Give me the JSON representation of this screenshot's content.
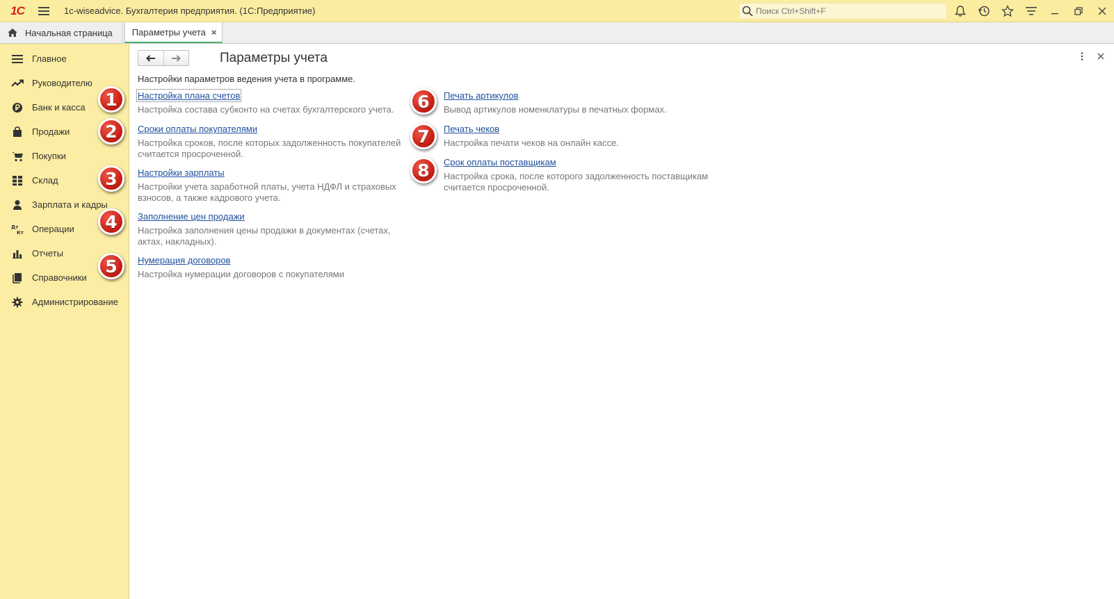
{
  "app": {
    "logo_text": "1С",
    "title": "1c-wiseadvice. Бухгалтерия предприятия.  (1С:Предприятие)",
    "search_placeholder": "Поиск Ctrl+Shift+F"
  },
  "tabs": {
    "home_label": "Начальная страница",
    "active_label": "Параметры учета",
    "close_glyph": "×"
  },
  "sidebar": {
    "items": [
      {
        "label": "Главное",
        "icon": "list-icon"
      },
      {
        "label": "Руководителю",
        "icon": "trend-icon"
      },
      {
        "label": "Банк и касса",
        "icon": "ruble-icon"
      },
      {
        "label": "Продажи",
        "icon": "bag-icon"
      },
      {
        "label": "Покупки",
        "icon": "cart-icon"
      },
      {
        "label": "Склад",
        "icon": "grid-icon"
      },
      {
        "label": "Зарплата и кадры",
        "icon": "person-icon"
      },
      {
        "label": "Операции",
        "icon": "dtkt-icon"
      },
      {
        "label": "Отчеты",
        "icon": "bar-chart-icon"
      },
      {
        "label": "Справочники",
        "icon": "book-icon"
      },
      {
        "label": "Администрирование",
        "icon": "gear-icon"
      }
    ]
  },
  "page": {
    "title": "Параметры учета",
    "subtitle": "Настройки параметров ведения учета в программе."
  },
  "params": [
    {
      "badge": "1",
      "link": "Настройка плана счетов",
      "desc": "Настройка состава субконто на счетах бухгалтерского учета."
    },
    {
      "badge": "2",
      "link": "Сроки оплаты покупателями",
      "desc": "Настройка сроков, после которых задолженность покупателей считается просроченной."
    },
    {
      "badge": "3",
      "link": "Настройки зарплаты",
      "desc": "Настройки учета заработной платы, учета НДФЛ и страховых взносов, а также кадрового учета."
    },
    {
      "badge": "4",
      "link": "Заполнение цен продажи",
      "desc": "Настройка заполнения цены продажи в документах (счетах, актах, накладных)."
    },
    {
      "badge": "5",
      "link": "Нумерация договоров",
      "desc": "Настройка нумерации договоров с покупателями"
    },
    {
      "badge": "6",
      "link": "Печать артикулов",
      "desc": "Вывод артикулов номенклатуры в печатных формах."
    },
    {
      "badge": "7",
      "link": "Печать чеков",
      "desc": "Настройка печати чеков на онлайн кассе."
    },
    {
      "badge": "8",
      "link": "Срок оплаты поставщикам",
      "desc": "Настройка срока, после которого задолженность поставщикам считается просроченной."
    }
  ],
  "colors": {
    "sidebar_bg": "#fbeda3",
    "link": "#1f4f9e",
    "badge": "#c81d14",
    "tab_accent": "#4caf6a"
  }
}
